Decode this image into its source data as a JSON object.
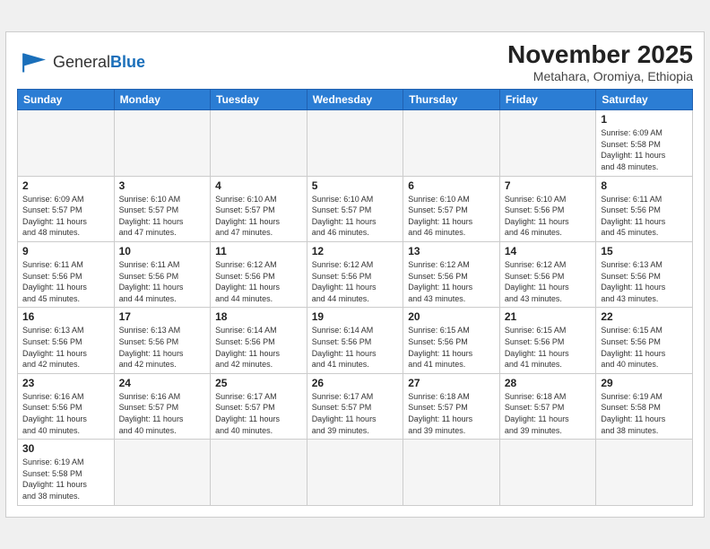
{
  "header": {
    "logo_general": "General",
    "logo_blue": "Blue",
    "month_title": "November 2025",
    "location": "Metahara, Oromiya, Ethiopia"
  },
  "days_of_week": [
    "Sunday",
    "Monday",
    "Tuesday",
    "Wednesday",
    "Thursday",
    "Friday",
    "Saturday"
  ],
  "weeks": [
    {
      "days": [
        {
          "number": "",
          "info": ""
        },
        {
          "number": "",
          "info": ""
        },
        {
          "number": "",
          "info": ""
        },
        {
          "number": "",
          "info": ""
        },
        {
          "number": "",
          "info": ""
        },
        {
          "number": "",
          "info": ""
        },
        {
          "number": "1",
          "info": "Sunrise: 6:09 AM\nSunset: 5:58 PM\nDaylight: 11 hours\nand 48 minutes."
        }
      ]
    },
    {
      "days": [
        {
          "number": "2",
          "info": "Sunrise: 6:09 AM\nSunset: 5:57 PM\nDaylight: 11 hours\nand 48 minutes."
        },
        {
          "number": "3",
          "info": "Sunrise: 6:10 AM\nSunset: 5:57 PM\nDaylight: 11 hours\nand 47 minutes."
        },
        {
          "number": "4",
          "info": "Sunrise: 6:10 AM\nSunset: 5:57 PM\nDaylight: 11 hours\nand 47 minutes."
        },
        {
          "number": "5",
          "info": "Sunrise: 6:10 AM\nSunset: 5:57 PM\nDaylight: 11 hours\nand 46 minutes."
        },
        {
          "number": "6",
          "info": "Sunrise: 6:10 AM\nSunset: 5:57 PM\nDaylight: 11 hours\nand 46 minutes."
        },
        {
          "number": "7",
          "info": "Sunrise: 6:10 AM\nSunset: 5:56 PM\nDaylight: 11 hours\nand 46 minutes."
        },
        {
          "number": "8",
          "info": "Sunrise: 6:11 AM\nSunset: 5:56 PM\nDaylight: 11 hours\nand 45 minutes."
        }
      ]
    },
    {
      "days": [
        {
          "number": "9",
          "info": "Sunrise: 6:11 AM\nSunset: 5:56 PM\nDaylight: 11 hours\nand 45 minutes."
        },
        {
          "number": "10",
          "info": "Sunrise: 6:11 AM\nSunset: 5:56 PM\nDaylight: 11 hours\nand 44 minutes."
        },
        {
          "number": "11",
          "info": "Sunrise: 6:12 AM\nSunset: 5:56 PM\nDaylight: 11 hours\nand 44 minutes."
        },
        {
          "number": "12",
          "info": "Sunrise: 6:12 AM\nSunset: 5:56 PM\nDaylight: 11 hours\nand 44 minutes."
        },
        {
          "number": "13",
          "info": "Sunrise: 6:12 AM\nSunset: 5:56 PM\nDaylight: 11 hours\nand 43 minutes."
        },
        {
          "number": "14",
          "info": "Sunrise: 6:12 AM\nSunset: 5:56 PM\nDaylight: 11 hours\nand 43 minutes."
        },
        {
          "number": "15",
          "info": "Sunrise: 6:13 AM\nSunset: 5:56 PM\nDaylight: 11 hours\nand 43 minutes."
        }
      ]
    },
    {
      "days": [
        {
          "number": "16",
          "info": "Sunrise: 6:13 AM\nSunset: 5:56 PM\nDaylight: 11 hours\nand 42 minutes."
        },
        {
          "number": "17",
          "info": "Sunrise: 6:13 AM\nSunset: 5:56 PM\nDaylight: 11 hours\nand 42 minutes."
        },
        {
          "number": "18",
          "info": "Sunrise: 6:14 AM\nSunset: 5:56 PM\nDaylight: 11 hours\nand 42 minutes."
        },
        {
          "number": "19",
          "info": "Sunrise: 6:14 AM\nSunset: 5:56 PM\nDaylight: 11 hours\nand 41 minutes."
        },
        {
          "number": "20",
          "info": "Sunrise: 6:15 AM\nSunset: 5:56 PM\nDaylight: 11 hours\nand 41 minutes."
        },
        {
          "number": "21",
          "info": "Sunrise: 6:15 AM\nSunset: 5:56 PM\nDaylight: 11 hours\nand 41 minutes."
        },
        {
          "number": "22",
          "info": "Sunrise: 6:15 AM\nSunset: 5:56 PM\nDaylight: 11 hours\nand 40 minutes."
        }
      ]
    },
    {
      "days": [
        {
          "number": "23",
          "info": "Sunrise: 6:16 AM\nSunset: 5:56 PM\nDaylight: 11 hours\nand 40 minutes."
        },
        {
          "number": "24",
          "info": "Sunrise: 6:16 AM\nSunset: 5:57 PM\nDaylight: 11 hours\nand 40 minutes."
        },
        {
          "number": "25",
          "info": "Sunrise: 6:17 AM\nSunset: 5:57 PM\nDaylight: 11 hours\nand 40 minutes."
        },
        {
          "number": "26",
          "info": "Sunrise: 6:17 AM\nSunset: 5:57 PM\nDaylight: 11 hours\nand 39 minutes."
        },
        {
          "number": "27",
          "info": "Sunrise: 6:18 AM\nSunset: 5:57 PM\nDaylight: 11 hours\nand 39 minutes."
        },
        {
          "number": "28",
          "info": "Sunrise: 6:18 AM\nSunset: 5:57 PM\nDaylight: 11 hours\nand 39 minutes."
        },
        {
          "number": "29",
          "info": "Sunrise: 6:19 AM\nSunset: 5:58 PM\nDaylight: 11 hours\nand 38 minutes."
        }
      ]
    },
    {
      "days": [
        {
          "number": "30",
          "info": "Sunrise: 6:19 AM\nSunset: 5:58 PM\nDaylight: 11 hours\nand 38 minutes."
        },
        {
          "number": "",
          "info": ""
        },
        {
          "number": "",
          "info": ""
        },
        {
          "number": "",
          "info": ""
        },
        {
          "number": "",
          "info": ""
        },
        {
          "number": "",
          "info": ""
        },
        {
          "number": "",
          "info": ""
        }
      ]
    }
  ]
}
